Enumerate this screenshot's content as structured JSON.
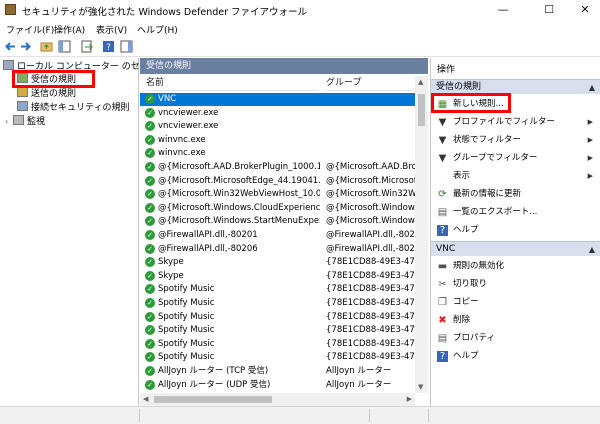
{
  "window": {
    "title": "セキュリティが強化された Windows Defender ファイアウォール",
    "minimize_glyph": "—",
    "maximize_glyph": "☐",
    "close_glyph": "✕"
  },
  "menu": [
    "ファイル(F)",
    "操作(A)",
    "表示(V)",
    "ヘルプ(H)"
  ],
  "toolbar": {
    "icons": [
      "back-arrow-icon",
      "forward-arrow-icon",
      "folder-up-icon",
      "show-hide-tree-icon",
      "export-list-icon",
      "help-icon",
      "show-hide-action-pane-icon"
    ]
  },
  "tree": {
    "root": "ローカル コンピューター のセキュリティ",
    "items": [
      "受信の規則",
      "送信の規則",
      "接続セキュリティの規則",
      "監視"
    ]
  },
  "list": {
    "header": "受信の規則",
    "col_name": "名前",
    "col_group": "グループ",
    "rows": [
      {
        "name": "VNC",
        "group": ""
      },
      {
        "name": "vncviewer.exe",
        "group": ""
      },
      {
        "name": "vncviewer.exe",
        "group": ""
      },
      {
        "name": "winvnc.exe",
        "group": ""
      },
      {
        "name": "winvnc.exe",
        "group": ""
      },
      {
        "name": "@{Microsoft.AAD.BrokerPlugin_1000.190...",
        "group": "@{Microsoft.AAD.Broke"
      },
      {
        "name": "@{Microsoft.MicrosoftEdge_44.19041.1.0...",
        "group": "@{Microsoft.Microsoft"
      },
      {
        "name": "@{Microsoft.Win32WebViewHost_10.0.19...",
        "group": "@{Microsoft.Win32We"
      },
      {
        "name": "@{Microsoft.Windows.CloudExperience...",
        "group": "@{Microsoft.Windows.C"
      },
      {
        "name": "@{Microsoft.Windows.StartMenuExperie...",
        "group": "@{Microsoft.Windows.S"
      },
      {
        "name": "@FirewallAPI.dll,-80201",
        "group": "@FirewallAPI.dll,-8020"
      },
      {
        "name": "@FirewallAPI.dll,-80206",
        "group": "@FirewallAPI.dll,-8020"
      },
      {
        "name": "Skype",
        "group": "{78E1CD88-49E3-476E-B"
      },
      {
        "name": "Skype",
        "group": "{78E1CD88-49E3-476E-B"
      },
      {
        "name": "Spotify Music",
        "group": "{78E1CD88-49E3-476E-B"
      },
      {
        "name": "Spotify Music",
        "group": "{78E1CD88-49E3-476E-B"
      },
      {
        "name": "Spotify Music",
        "group": "{78E1CD88-49E3-476E-B"
      },
      {
        "name": "Spotify Music",
        "group": "{78E1CD88-49E3-476E-B"
      },
      {
        "name": "Spotify Music",
        "group": "{78E1CD88-49E3-476E-B"
      },
      {
        "name": "Spotify Music",
        "group": "{78E1CD88-49E3-476E-B"
      },
      {
        "name": "AllJoyn ルーター (TCP 受信)",
        "group": "AllJoyn ルーター"
      },
      {
        "name": "AllJoyn ルーター (UDP 受信)",
        "group": "AllJoyn ルーター"
      }
    ],
    "selected_index": 0
  },
  "actions": {
    "title": "操作",
    "section1": "受信の規則",
    "items1": [
      {
        "label": "新しい規則...",
        "icon": "new-rule-icon"
      },
      {
        "label": "プロファイルでフィルター",
        "icon": "filter-icon",
        "submenu": true
      },
      {
        "label": "状態でフィルター",
        "icon": "filter-icon",
        "submenu": true
      },
      {
        "label": "グループでフィルター",
        "icon": "filter-icon",
        "submenu": true
      },
      {
        "label": "表示",
        "icon": "",
        "submenu": true
      },
      {
        "label": "最新の情報に更新",
        "icon": "refresh-icon"
      },
      {
        "label": "一覧のエクスポート...",
        "icon": "export-icon"
      },
      {
        "label": "ヘルプ",
        "icon": "help-icon"
      }
    ],
    "section2": "VNC",
    "items2": [
      {
        "label": "規則の無効化",
        "icon": "disable-rule-icon"
      },
      {
        "label": "切り取り",
        "icon": "cut-icon"
      },
      {
        "label": "コピー",
        "icon": "copy-icon"
      },
      {
        "label": "削除",
        "icon": "delete-icon"
      },
      {
        "label": "プロパティ",
        "icon": "properties-icon"
      },
      {
        "label": "ヘルプ",
        "icon": "help-icon"
      }
    ]
  },
  "colors": {
    "accent": "#0078d7",
    "highlight_red": "#ff0000",
    "enabled_green": "#2e9b3a",
    "pane_header": "#6b7fa0",
    "section_bg": "#d7dfee"
  }
}
